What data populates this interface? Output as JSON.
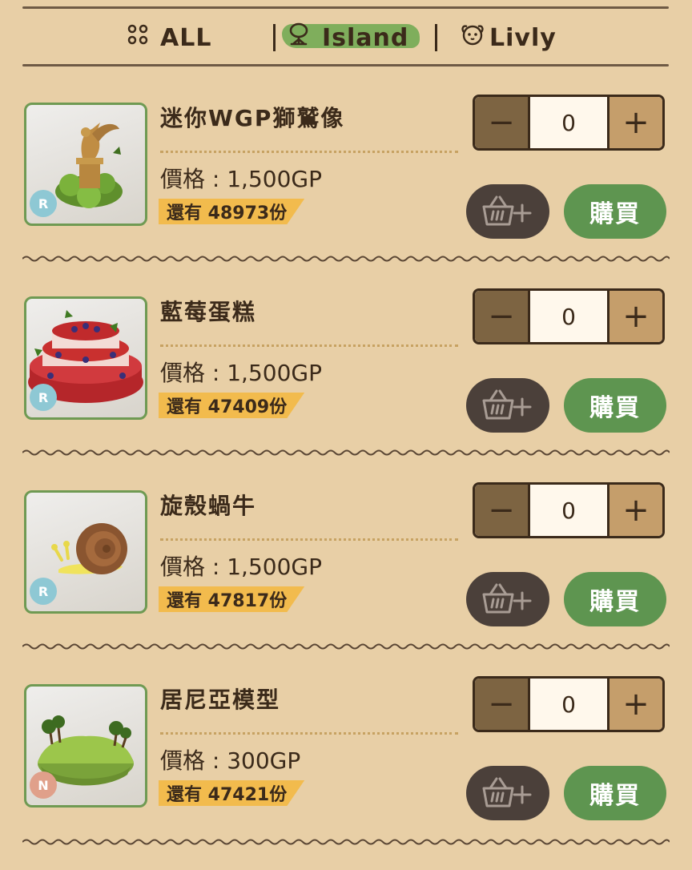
{
  "tabs": [
    {
      "label": "ALL",
      "icon": "grid-dots-icon"
    },
    {
      "label": "Island",
      "icon": "island-tree-icon",
      "active": true
    },
    {
      "label": "Livly",
      "icon": "livly-face-icon"
    }
  ],
  "colors": {
    "active_highlight": "#7fae5c",
    "buy_button": "#5e9550",
    "stock_tag": "#f2bb4d"
  },
  "items": [
    {
      "name": "迷你WGP獅鷲像",
      "rarity": "R",
      "price": "價格 : 1,500GP",
      "stock": "還有 48973份",
      "qty": "0",
      "buy_label": "購買",
      "image": "griffin-statue"
    },
    {
      "name": "藍莓蛋糕",
      "rarity": "R",
      "price": "價格 : 1,500GP",
      "stock": "還有 47409份",
      "qty": "0",
      "buy_label": "購買",
      "image": "blueberry-cake"
    },
    {
      "name": "旋殼蝸牛",
      "rarity": "R",
      "price": "價格 : 1,500GP",
      "stock": "還有 47817份",
      "qty": "0",
      "buy_label": "購買",
      "image": "snail"
    },
    {
      "name": "居尼亞模型",
      "rarity": "N",
      "price": "價格 : 300GP",
      "stock": "還有 47421份",
      "qty": "0",
      "buy_label": "購買",
      "image": "island-model"
    }
  ]
}
